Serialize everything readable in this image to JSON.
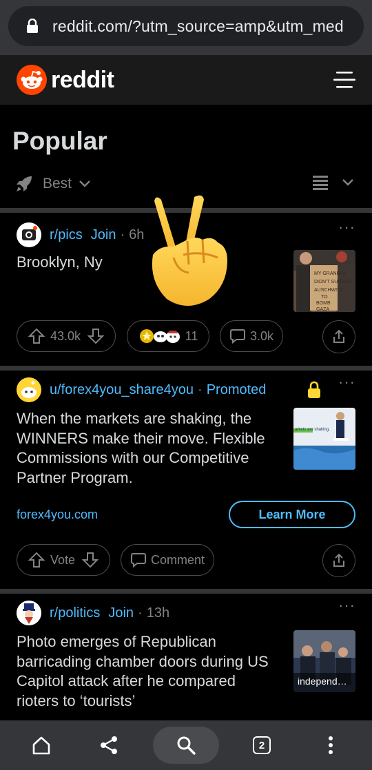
{
  "browser": {
    "url": "reddit.com/?utm_source=amp&utm_med"
  },
  "header": {
    "wordmark": "reddit"
  },
  "page": {
    "title": "Popular",
    "sort_label": "Best"
  },
  "posts": [
    {
      "subreddit": "r/pics",
      "join": "Join",
      "age": "6h",
      "title": "Brooklyn, Ny",
      "upvotes": "43.0k",
      "awards_count": "11",
      "comments": "3.0k"
    },
    {
      "author": "u/forex4you_share4you",
      "promoted": "Promoted",
      "title": "When the markets are shaking, the WINNERS make their move. Flexible Commissions with our Competitive Partner Program.",
      "domain": "forex4you.com",
      "cta": "Learn More",
      "vote": "Vote",
      "comment": "Comment",
      "thumb_text": "arkets are shaking,"
    },
    {
      "subreddit": "r/politics",
      "join": "Join",
      "age": "13h",
      "title": "Photo emerges of Republican barricading chamber doors during US Capitol attack after he compared rioters to ‘tourists’",
      "thumb_caption": "independ…"
    }
  ],
  "bottom_nav": {
    "tab_count": "2"
  },
  "colors": {
    "accent_blue": "#4fbcff",
    "reddit_orange": "#ff4500",
    "text_primary": "#d7dadc",
    "text_muted": "#818384"
  }
}
